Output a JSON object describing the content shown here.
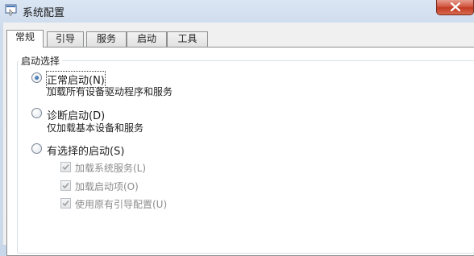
{
  "window": {
    "title": "系统配置",
    "icon": "system-config-icon",
    "close_icon": "close-icon"
  },
  "tabs": [
    {
      "label": "常规",
      "active": true
    },
    {
      "label": "引导",
      "active": false
    },
    {
      "label": "服务",
      "active": false
    },
    {
      "label": "启动",
      "active": false
    },
    {
      "label": "工具",
      "active": false
    }
  ],
  "startup_selection": {
    "group_label": "启动选择",
    "options": [
      {
        "label": "正常启动(N)",
        "description": "加载所有设备驱动程序和服务",
        "checked": true
      },
      {
        "label": "诊断启动(D)",
        "description": "仅加载基本设备和服务",
        "checked": false
      },
      {
        "label": "有选择的启动(S)",
        "checked": false
      }
    ],
    "selective_items": [
      {
        "label": "加载系统服务(L)",
        "checked": true,
        "enabled": false
      },
      {
        "label": "加载启动项(O)",
        "checked": true,
        "enabled": false
      },
      {
        "label": "使用原有引导配置(U)",
        "checked": true,
        "enabled": false
      }
    ]
  },
  "colors": {
    "accent": "#1a4f8c",
    "close_button": "#c23a22",
    "disabled_text": "#8c8c8c"
  }
}
